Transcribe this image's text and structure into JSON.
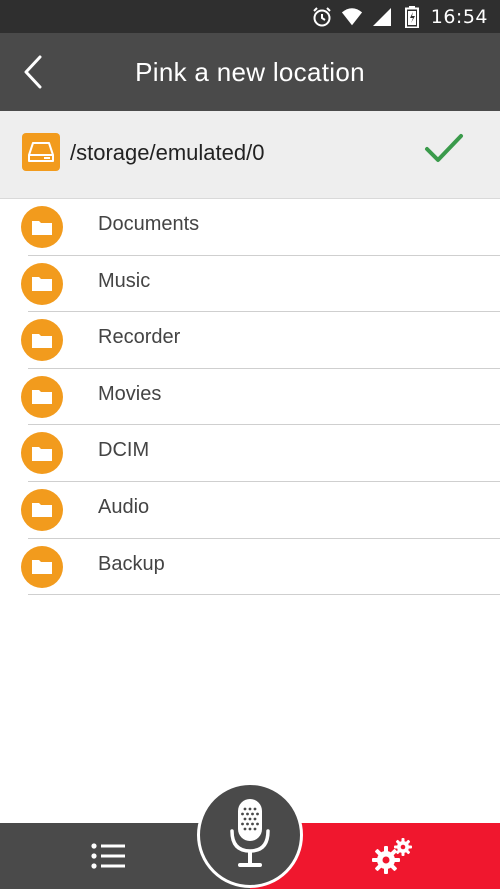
{
  "status_bar": {
    "time": "16:54",
    "icons": [
      "alarm-icon",
      "wifi-icon",
      "signal-icon",
      "battery-icon"
    ]
  },
  "header": {
    "title": "Pink a new location",
    "back_icon": "chevron-left-icon"
  },
  "path_row": {
    "path": "/storage/emulated/0",
    "drive_icon": "drive-icon",
    "confirm_icon": "checkmark-icon"
  },
  "folders": [
    {
      "label": "Documents"
    },
    {
      "label": "Music"
    },
    {
      "label": "Recorder"
    },
    {
      "label": "Movies"
    },
    {
      "label": "DCIM"
    },
    {
      "label": "Audio"
    },
    {
      "label": "Backup"
    }
  ],
  "bottom_bar": {
    "left_icon": "list-icon",
    "center_icon": "microphone-icon",
    "right_icon": "gear-icon"
  },
  "colors": {
    "header": "#4a4a4a",
    "status_bar": "#2f2f2f",
    "accent_orange": "#f29b1d",
    "accent_red": "#f0172e",
    "check_green": "#3a9a4b"
  }
}
